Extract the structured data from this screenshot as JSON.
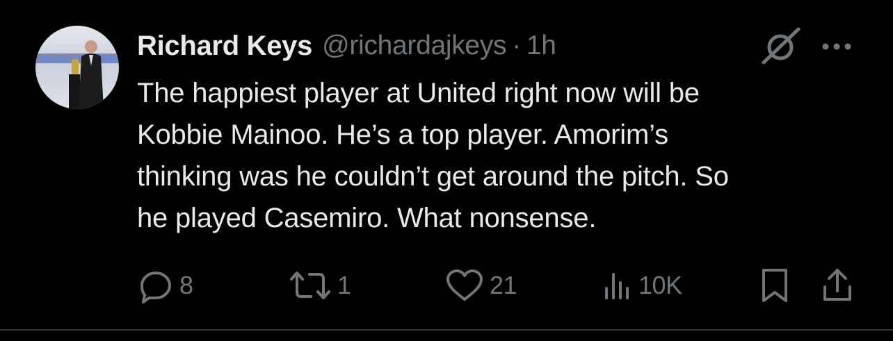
{
  "author": {
    "display_name": "Richard Keys",
    "handle": "@richardajkeys",
    "separator": "·",
    "time": "1h"
  },
  "tweet": {
    "lines": [
      "The happiest player at United right now will be",
      "Kobbie Mainoo. He’s a top player. Amorim’s",
      "thinking was he couldn’t get around the pitch. So",
      "he played Casemiro. What nonsense."
    ]
  },
  "actions": {
    "replies": "8",
    "reposts": "1",
    "likes": "21",
    "views": "10K"
  },
  "icons": {
    "avatar": "profile-photo",
    "grok": "grok-icon",
    "more": "more-options-icon",
    "reply": "reply-icon",
    "repost": "repost-icon",
    "like": "heart-icon",
    "views": "views-icon",
    "bookmark": "bookmark-icon",
    "share": "share-icon"
  },
  "colors": {
    "background": "#000000",
    "primary_text": "#e7e9ea",
    "secondary_text": "#71767b",
    "divider": "#2f3336"
  }
}
